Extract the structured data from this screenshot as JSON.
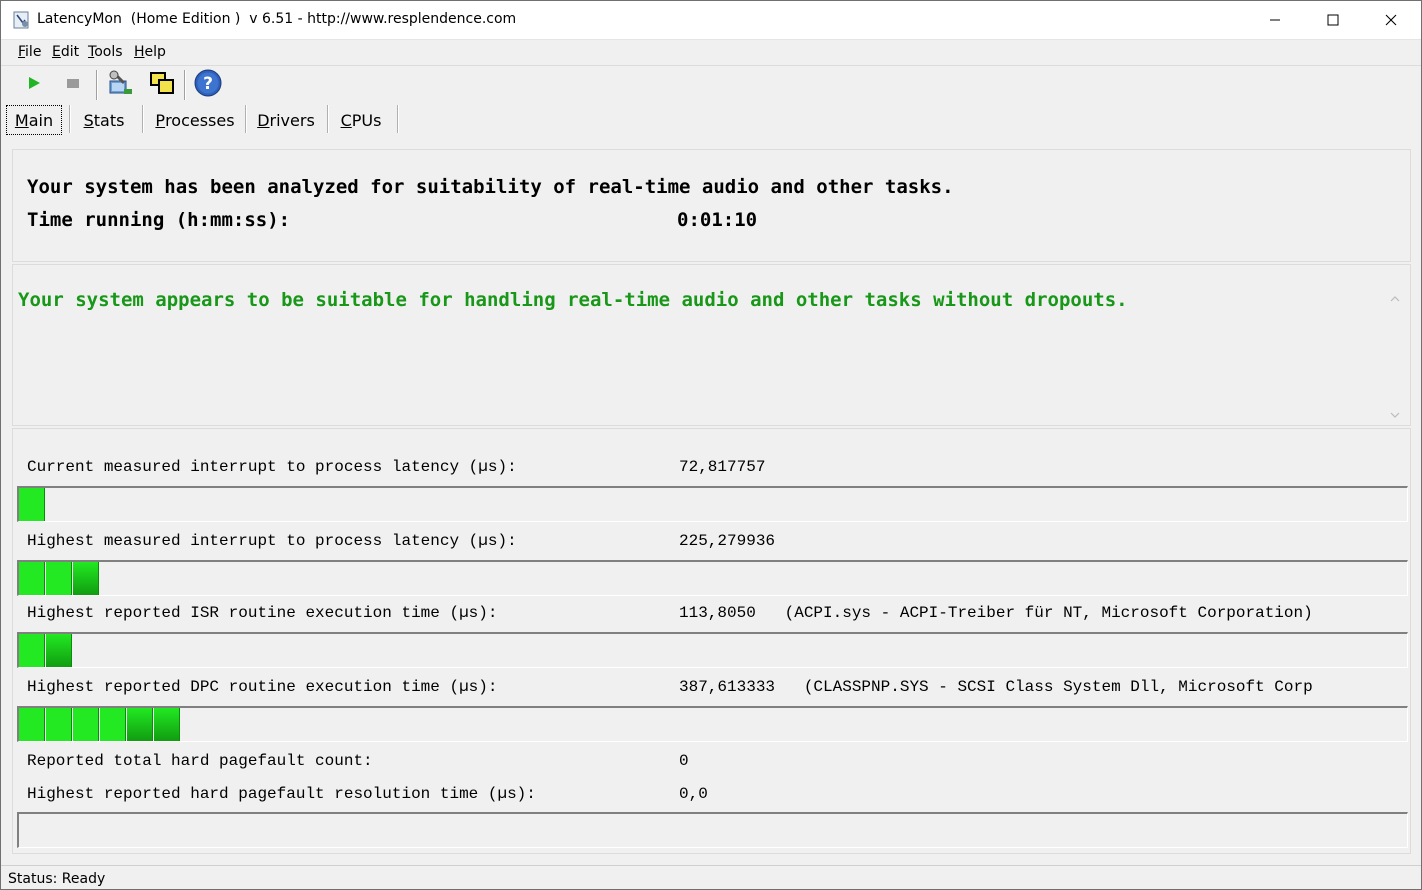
{
  "window": {
    "title": "LatencyMon  (Home Edition )  v 6.51 - http://www.resplendence.com",
    "controls": {
      "minimize": "minimize-icon",
      "maximize": "maximize-icon",
      "close": "close-icon"
    }
  },
  "menu": {
    "items": [
      {
        "accel": "F",
        "rest": "ile"
      },
      {
        "accel": "E",
        "rest": "dit"
      },
      {
        "accel": "T",
        "rest": "ools"
      },
      {
        "accel": "H",
        "rest": "elp"
      }
    ]
  },
  "toolbar": {
    "buttons": [
      "play-icon",
      "stop-icon",
      "analyze-icon",
      "windows-icon",
      "help-icon"
    ]
  },
  "tabs": {
    "items": [
      {
        "accel": "M",
        "rest": "ain"
      },
      {
        "accel": "S",
        "rest": "tats"
      },
      {
        "accel": "P",
        "rest": "rocesses"
      },
      {
        "accel": "D",
        "rest": "rivers"
      },
      {
        "accel": "C",
        "rest": "PUs"
      }
    ],
    "active_index": 0
  },
  "summary": {
    "analyzed": "Your system has been analyzed for suitability of real-time audio and other tasks.",
    "time_label": "Time running (h:mm:ss):",
    "time_value": "0:01:10"
  },
  "verdict": {
    "text": "Your system appears to be suitable for handling real-time audio and other tasks without dropouts.",
    "color": "#189718"
  },
  "metrics": {
    "current_latency": {
      "label": "Current measured interrupt to process latency (µs):",
      "value": "72,817757",
      "segments": 1
    },
    "highest_latency": {
      "label": "Highest measured interrupt to process latency (µs):",
      "value": "225,279936",
      "segments": 3
    },
    "isr": {
      "label": "Highest reported ISR routine execution time (µs):",
      "value": "113,8050   (ACPI.sys - ACPI-Treiber für NT, Microsoft Corporation)",
      "segments": 2
    },
    "dpc": {
      "label": "Highest reported DPC routine execution time (µs):",
      "value": "387,613333   (CLASSPNP.SYS - SCSI Class System Dll, Microsoft Corp",
      "segments": 6
    },
    "pagefault_count": {
      "label": "Reported total hard pagefault count:",
      "value": "0"
    },
    "pagefault_time": {
      "label": "Highest reported hard pagefault resolution time (µs):",
      "value": "0,0",
      "segments": 0
    }
  },
  "colors": {
    "bar_green_light": "#22e922",
    "bar_green_dark": "#109a10",
    "window_bg": "#f0f0f0"
  },
  "status": {
    "text": "Status: Ready"
  }
}
